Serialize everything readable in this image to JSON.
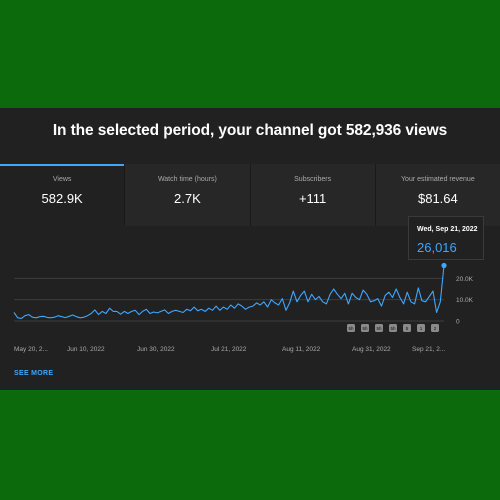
{
  "headline": "In the selected period, your channel got 582,936 views",
  "tabs": [
    {
      "label": "Views",
      "value": "582.9K"
    },
    {
      "label": "Watch time (hours)",
      "value": "2.7K"
    },
    {
      "label": "Subscribers",
      "value": "+111"
    },
    {
      "label": "Your estimated revenue",
      "value": "$81.64"
    }
  ],
  "tooltip": {
    "date": "Wed, Sep 21, 2022",
    "value": "26,016"
  },
  "see_more": "SEE MORE",
  "colors": {
    "accent": "#3ea6ff",
    "panel": "#212121",
    "background": "#0c6a0c"
  },
  "chart_data": {
    "type": "line",
    "x_tick_labels": [
      "May 20, 2...",
      "Jun 10, 2022",
      "Jun 30, 2022",
      "Jul 21, 2022",
      "Aug 11, 2022",
      "Aug 31, 2022",
      "Sep 21, 2..."
    ],
    "y_tick_labels": [
      "20.0K",
      "10.0K",
      "0"
    ],
    "ylim": [
      0,
      30000
    ],
    "marker_labels": [
      "5h",
      "5h",
      "5h",
      "5h",
      "5",
      "1",
      "2"
    ],
    "series": [
      {
        "values": [
          4000,
          1500,
          1200,
          2500,
          3000,
          1800,
          1500,
          2000,
          2200,
          1700,
          1500,
          1800,
          2500,
          2000,
          1600,
          2200,
          2800,
          2000,
          1500,
          1800,
          2500,
          3500,
          5200,
          3000,
          4500,
          3500,
          6000,
          4500,
          4500,
          3200,
          4500,
          3500,
          4500,
          5000,
          3000,
          4500,
          5500,
          3500,
          4200,
          3800,
          4500,
          5200,
          3500,
          4500,
          5000,
          4500,
          4000,
          5500,
          4800,
          6500,
          4800,
          5500,
          4500,
          6000,
          5000,
          7000,
          5000,
          6500,
          5500,
          7500,
          6000,
          8000,
          7000,
          5500,
          6500,
          7000,
          8500,
          7500,
          9000,
          6500,
          10000,
          8500,
          7500,
          10500,
          5000,
          8500,
          14000,
          9000,
          12000,
          14000,
          9000,
          12500,
          10000,
          11500,
          9000,
          8000,
          12500,
          15000,
          12500,
          10500,
          13000,
          8000,
          13000,
          11000,
          10000,
          14500,
          12500,
          9000,
          9500,
          10500,
          7000,
          12000,
          13500,
          11000,
          15000,
          11000,
          8000,
          13500,
          9000,
          8000,
          15500,
          9500,
          9000,
          11500,
          14000,
          4000,
          9000,
          26016
        ]
      }
    ]
  }
}
